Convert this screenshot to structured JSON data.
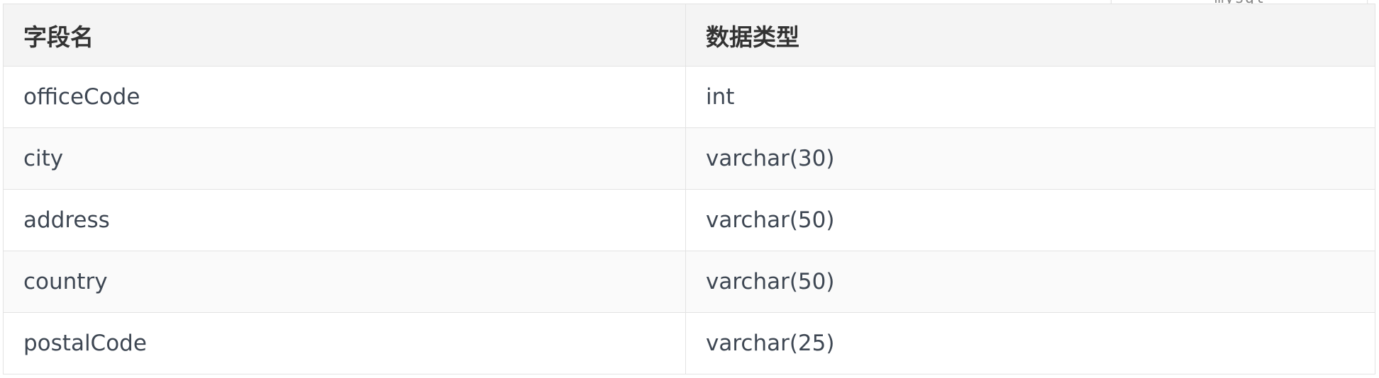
{
  "code_tab": {
    "language": "mysql"
  },
  "table": {
    "headers": [
      "字段名",
      "数据类型"
    ],
    "rows": [
      [
        "officeCode",
        "int"
      ],
      [
        "city",
        "varchar(30)"
      ],
      [
        "address",
        "varchar(50)"
      ],
      [
        "country",
        "varchar(50)"
      ],
      [
        "postalCode",
        "varchar(25)"
      ]
    ]
  }
}
